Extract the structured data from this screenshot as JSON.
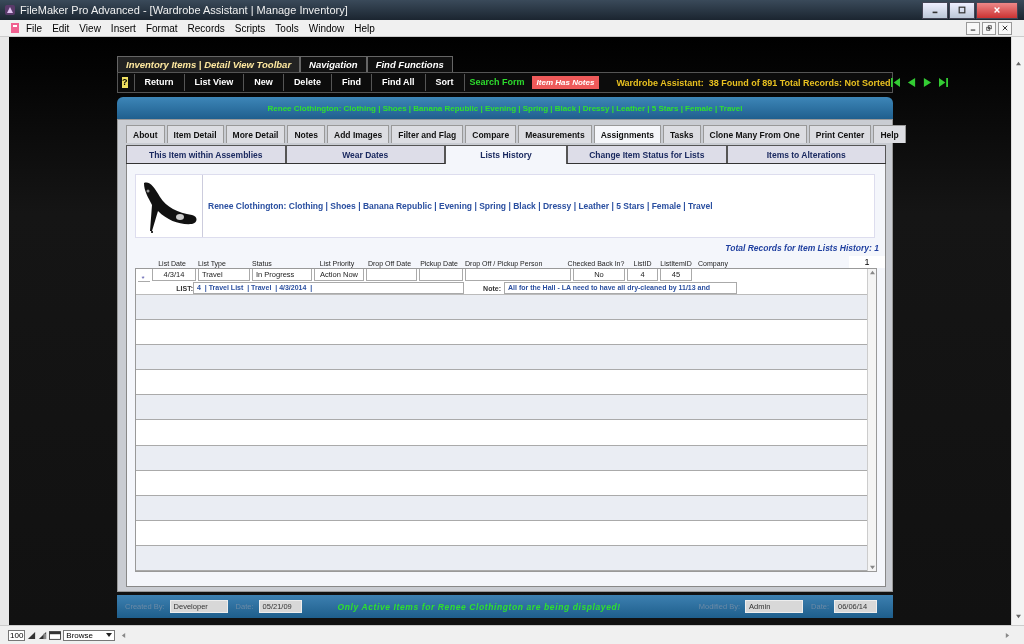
{
  "window": {
    "title": "FileMaker Pro Advanced - [Wardrobe Assistant | Manage Inventory]"
  },
  "menu": [
    "File",
    "Edit",
    "View",
    "Insert",
    "Format",
    "Records",
    "Scripts",
    "Tools",
    "Window",
    "Help"
  ],
  "toolbar": {
    "tabs": [
      {
        "label": "Inventory Items | Detail View Toolbar",
        "selected": true
      },
      {
        "label": "Navigation",
        "selected": false
      },
      {
        "label": "Find Functions",
        "selected": false
      }
    ],
    "buttons": [
      {
        "kind": "help",
        "label": "?"
      },
      {
        "kind": "plain",
        "label": "Return"
      },
      {
        "kind": "plain",
        "label": "List View"
      },
      {
        "kind": "plain",
        "label": "New"
      },
      {
        "kind": "plain",
        "label": "Delete"
      },
      {
        "kind": "plain",
        "label": "Find"
      },
      {
        "kind": "plain",
        "label": "Find All"
      },
      {
        "kind": "plain",
        "label": "Sort"
      },
      {
        "kind": "search",
        "label": "Search Form"
      },
      {
        "kind": "notes",
        "label": "Item Has Notes"
      }
    ],
    "status": "Wardrobe Assistant:  38 Found of 891 Total Records: Not Sorted"
  },
  "header": "Renee Clothington: Clothing | Shoes | Banana Republic | Evening | Spring | Black | Dressy | Leather | 5 Stars | Female | Travel",
  "tabs": [
    {
      "label": "About",
      "selected": false
    },
    {
      "label": "Item Detail",
      "selected": false
    },
    {
      "label": "More Detail",
      "selected": false
    },
    {
      "label": "Notes",
      "selected": false
    },
    {
      "label": "Add Images",
      "selected": false
    },
    {
      "label": "Filter and Flag",
      "selected": false
    },
    {
      "label": "Compare",
      "selected": false
    },
    {
      "label": "Measurements",
      "selected": false
    },
    {
      "label": "Assignments",
      "selected": true
    },
    {
      "label": "Tasks",
      "selected": false
    },
    {
      "label": "Clone Many From One",
      "selected": false
    },
    {
      "label": "Print Center",
      "selected": false
    },
    {
      "label": "Help",
      "selected": false
    }
  ],
  "subtabs": [
    {
      "label": "This Item within Assemblies",
      "selected": false
    },
    {
      "label": "Wear Dates",
      "selected": false
    },
    {
      "label": "Lists History",
      "selected": true
    },
    {
      "label": "Change Item Status for Lists",
      "selected": false
    },
    {
      "label": "Items to Alterations",
      "selected": false
    }
  ],
  "item": {
    "description": "Renee Clothington: Clothing | Shoes | Banana Republic | Evening | Spring | Black | Dressy | Leather | 5 Stars | Female | Travel"
  },
  "total_records": "Total Records for Item Lists History: 1",
  "record_counter": "1",
  "columns": [
    "List Date",
    "List Type",
    "Status",
    "List Priority",
    "Drop Off Date",
    "Pickup Date",
    "Drop Off / Pickup Person",
    "Checked Back In?",
    "ListID",
    "ListItemID",
    "Company"
  ],
  "rows": [
    {
      "marker": "*",
      "cells": [
        "4/3/14",
        "Travel",
        "In Progress",
        "Action Now",
        "",
        "",
        "",
        "No",
        "4",
        "45",
        ""
      ],
      "list_label": "LIST:",
      "list": "4  | Travel List  | Travel  | 4/3/2014  |",
      "note_label": "Note:",
      "note": "All for the Hall - LA need to have all dry-cleaned by 11/13 and"
    }
  ],
  "footer": {
    "created_by_label": "Created By:",
    "created_by": "Developer",
    "created_date_label": "Date:",
    "created_date": "05/21/09",
    "message": "Only Active Items for Renee Clothington are being displayed!",
    "modified_by_label": "Modified By:",
    "modified_by": "Admin",
    "modified_date_label": "Date:",
    "modified_date": "06/06/14"
  },
  "status_bar": {
    "zoom": "100",
    "mode": "Browse"
  }
}
